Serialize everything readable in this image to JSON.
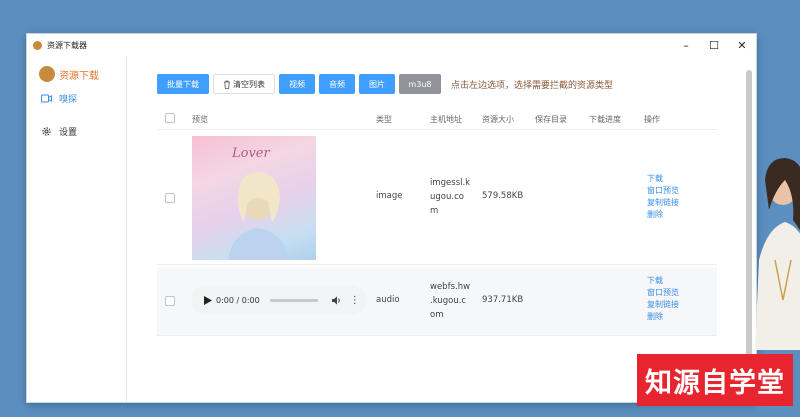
{
  "window": {
    "title": "资源下载器"
  },
  "sidebar": {
    "brand": "资源下载",
    "items": [
      {
        "label": "嗅探",
        "icon": "video-icon"
      },
      {
        "label": "设置",
        "icon": "gear-icon"
      }
    ]
  },
  "toolbar": {
    "batch_download": "批量下载",
    "clear_list": "清空列表",
    "filters": [
      "视频",
      "音频",
      "图片",
      "m3u8"
    ],
    "hint": "点击左边选项，选择需要拦截的资源类型"
  },
  "table": {
    "headers": [
      "预览",
      "类型",
      "主机地址",
      "资源大小",
      "保存目录",
      "下载进度",
      "操作"
    ],
    "rows": [
      {
        "type": "image",
        "host_lines": [
          "imgessl.k",
          "ugou.co",
          "m"
        ],
        "size": "579.58KB",
        "preview_text": "Lover",
        "actions": [
          "下载",
          "窗口预览",
          "复制链接",
          "删除"
        ]
      },
      {
        "type": "audio",
        "host_lines": [
          "webfs.hw",
          ".kugou.c",
          "om"
        ],
        "size": "937.71KB",
        "audio_time": "0:00 / 0:00",
        "actions": [
          "下载",
          "窗口预览",
          "复制链接",
          "删除"
        ]
      }
    ]
  },
  "colors": {
    "accent": "#409eff",
    "brand": "#e8742c",
    "link": "#3a8ee6",
    "watermark": "#e8252e"
  },
  "watermark": "知源自学堂"
}
